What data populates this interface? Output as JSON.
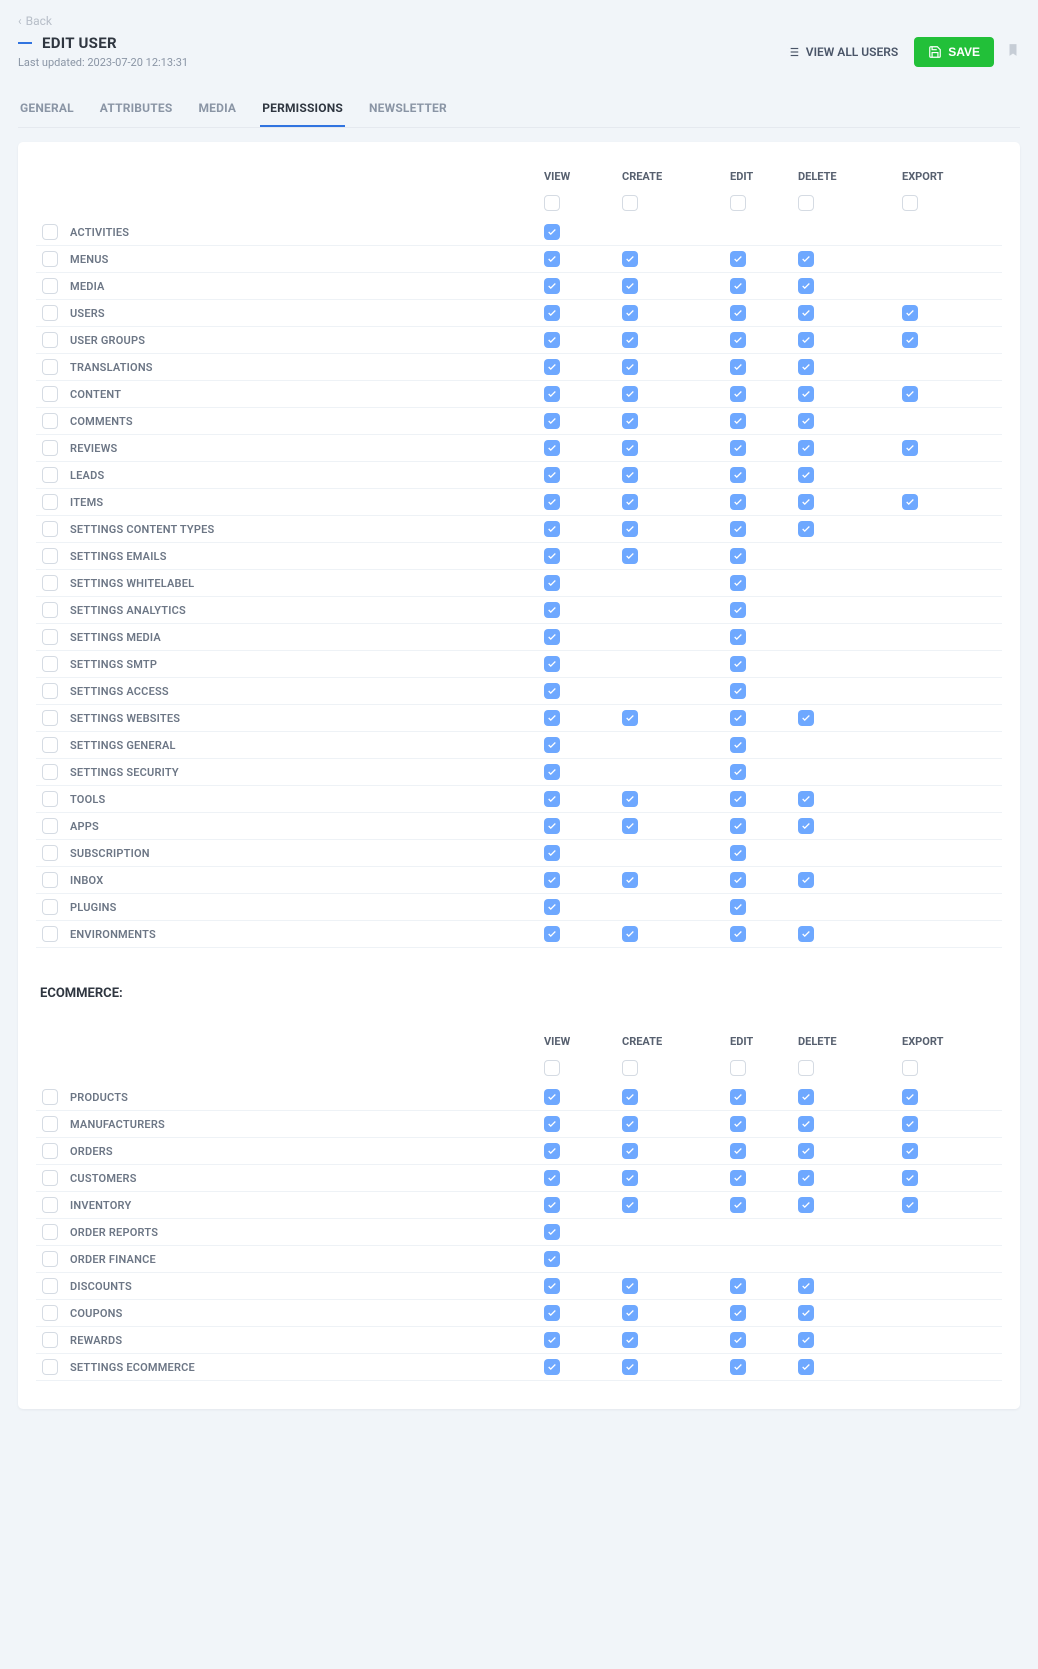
{
  "back_label": "Back",
  "page_title": "EDIT USER",
  "last_updated": "Last updated: 2023-07-20 12:13:31",
  "actions": {
    "view_all": "VIEW ALL USERS",
    "save": "SAVE"
  },
  "tabs": [
    {
      "id": "general",
      "label": "GENERAL",
      "active": false
    },
    {
      "id": "attributes",
      "label": "ATTRIBUTES",
      "active": false
    },
    {
      "id": "media",
      "label": "MEDIA",
      "active": false
    },
    {
      "id": "permissions",
      "label": "PERMISSIONS",
      "active": true
    },
    {
      "id": "newsletter",
      "label": "NEWSLETTER",
      "active": false
    }
  ],
  "columns": [
    "VIEW",
    "CREATE",
    "EDIT",
    "DELETE",
    "EXPORT"
  ],
  "sections": [
    {
      "title": null,
      "header_checks": [
        false,
        false,
        false,
        false,
        false
      ],
      "rows": [
        {
          "label": "ACTIVITIES",
          "perm": [
            true,
            null,
            null,
            null,
            null
          ]
        },
        {
          "label": "MENUS",
          "perm": [
            true,
            true,
            true,
            true,
            null
          ]
        },
        {
          "label": "MEDIA",
          "perm": [
            true,
            true,
            true,
            true,
            null
          ]
        },
        {
          "label": "USERS",
          "perm": [
            true,
            true,
            true,
            true,
            true
          ]
        },
        {
          "label": "USER GROUPS",
          "perm": [
            true,
            true,
            true,
            true,
            true
          ]
        },
        {
          "label": "TRANSLATIONS",
          "perm": [
            true,
            true,
            true,
            true,
            null
          ]
        },
        {
          "label": "CONTENT",
          "perm": [
            true,
            true,
            true,
            true,
            true
          ]
        },
        {
          "label": "COMMENTS",
          "perm": [
            true,
            true,
            true,
            true,
            null
          ]
        },
        {
          "label": "REVIEWS",
          "perm": [
            true,
            true,
            true,
            true,
            true
          ]
        },
        {
          "label": "LEADS",
          "perm": [
            true,
            true,
            true,
            true,
            null
          ]
        },
        {
          "label": "ITEMS",
          "perm": [
            true,
            true,
            true,
            true,
            true
          ]
        },
        {
          "label": "SETTINGS CONTENT TYPES",
          "perm": [
            true,
            true,
            true,
            true,
            null
          ]
        },
        {
          "label": "SETTINGS EMAILS",
          "perm": [
            true,
            true,
            true,
            null,
            null
          ]
        },
        {
          "label": "SETTINGS WHITELABEL",
          "perm": [
            true,
            null,
            true,
            null,
            null
          ]
        },
        {
          "label": "SETTINGS ANALYTICS",
          "perm": [
            true,
            null,
            true,
            null,
            null
          ]
        },
        {
          "label": "SETTINGS MEDIA",
          "perm": [
            true,
            null,
            true,
            null,
            null
          ]
        },
        {
          "label": "SETTINGS SMTP",
          "perm": [
            true,
            null,
            true,
            null,
            null
          ]
        },
        {
          "label": "SETTINGS ACCESS",
          "perm": [
            true,
            null,
            true,
            null,
            null
          ]
        },
        {
          "label": "SETTINGS WEBSITES",
          "perm": [
            true,
            true,
            true,
            true,
            null
          ]
        },
        {
          "label": "SETTINGS GENERAL",
          "perm": [
            true,
            null,
            true,
            null,
            null
          ]
        },
        {
          "label": "SETTINGS SECURITY",
          "perm": [
            true,
            null,
            true,
            null,
            null
          ]
        },
        {
          "label": "TOOLS",
          "perm": [
            true,
            true,
            true,
            true,
            null
          ]
        },
        {
          "label": "APPS",
          "perm": [
            true,
            true,
            true,
            true,
            null
          ]
        },
        {
          "label": "SUBSCRIPTION",
          "perm": [
            true,
            null,
            true,
            null,
            null
          ]
        },
        {
          "label": "INBOX",
          "perm": [
            true,
            true,
            true,
            true,
            null
          ]
        },
        {
          "label": "PLUGINS",
          "perm": [
            true,
            null,
            true,
            null,
            null
          ]
        },
        {
          "label": "ENVIRONMENTS",
          "perm": [
            true,
            true,
            true,
            true,
            null
          ]
        }
      ]
    },
    {
      "title": "ECOMMERCE:",
      "header_checks": [
        false,
        false,
        false,
        false,
        false
      ],
      "rows": [
        {
          "label": "PRODUCTS",
          "perm": [
            true,
            true,
            true,
            true,
            true
          ]
        },
        {
          "label": "MANUFACTURERS",
          "perm": [
            true,
            true,
            true,
            true,
            true
          ]
        },
        {
          "label": "ORDERS",
          "perm": [
            true,
            true,
            true,
            true,
            true
          ]
        },
        {
          "label": "CUSTOMERS",
          "perm": [
            true,
            true,
            true,
            true,
            true
          ]
        },
        {
          "label": "INVENTORY",
          "perm": [
            true,
            true,
            true,
            true,
            true
          ]
        },
        {
          "label": "ORDER REPORTS",
          "perm": [
            true,
            null,
            null,
            null,
            null
          ]
        },
        {
          "label": "ORDER FINANCE",
          "perm": [
            true,
            null,
            null,
            null,
            null
          ]
        },
        {
          "label": "DISCOUNTS",
          "perm": [
            true,
            true,
            true,
            true,
            null
          ]
        },
        {
          "label": "COUPONS",
          "perm": [
            true,
            true,
            true,
            true,
            null
          ]
        },
        {
          "label": "REWARDS",
          "perm": [
            true,
            true,
            true,
            true,
            null
          ]
        },
        {
          "label": "SETTINGS ECOMMERCE",
          "perm": [
            true,
            true,
            true,
            true,
            null
          ]
        }
      ]
    }
  ]
}
